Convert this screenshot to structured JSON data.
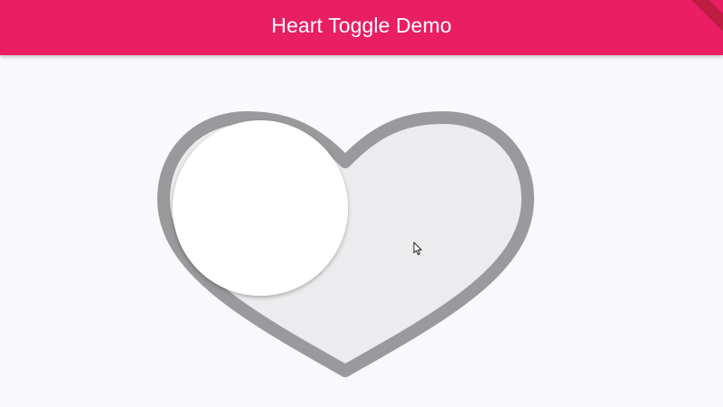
{
  "app": {
    "title": "Heart Toggle Demo"
  },
  "toggle": {
    "state": "off",
    "track_color": "#ecebed",
    "border_color": "#9a999b",
    "thumb_color": "#ffffff"
  },
  "colors": {
    "appbar": "#e91e63",
    "background": "#f9f8fa"
  }
}
